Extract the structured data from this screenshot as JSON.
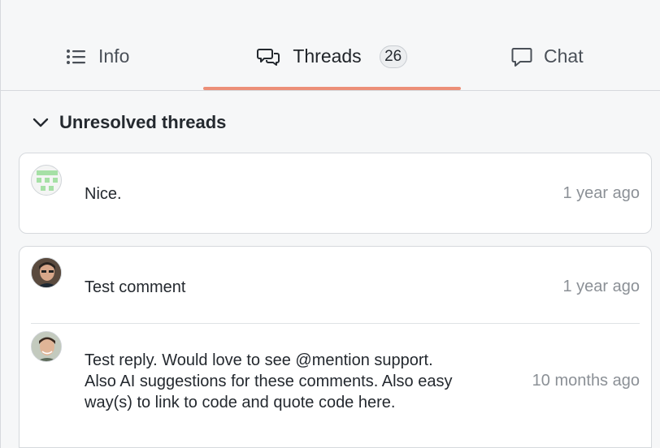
{
  "tabs": {
    "info_label": "Info",
    "threads_label": "Threads",
    "threads_count": "26",
    "chat_label": "Chat",
    "active": "Threads",
    "accent_color": "#ec8f78"
  },
  "section": {
    "title": "Unresolved threads",
    "icon": "chevron-down-icon"
  },
  "threads": [
    {
      "comments": [
        {
          "avatar": "identicon-avatar",
          "text": "Nice.",
          "time": "1 year ago"
        }
      ]
    },
    {
      "comments": [
        {
          "avatar": "user-photo-avatar",
          "text": "Test comment",
          "time": "1 year ago"
        },
        {
          "avatar": "user-photo-avatar",
          "text_lines": [
            "Test reply. Would love to see @mention support.",
            "Also AI suggestions for these comments. Also easy",
            "way(s) to link to code and quote code here."
          ],
          "time": "10 months ago"
        }
      ]
    }
  ]
}
